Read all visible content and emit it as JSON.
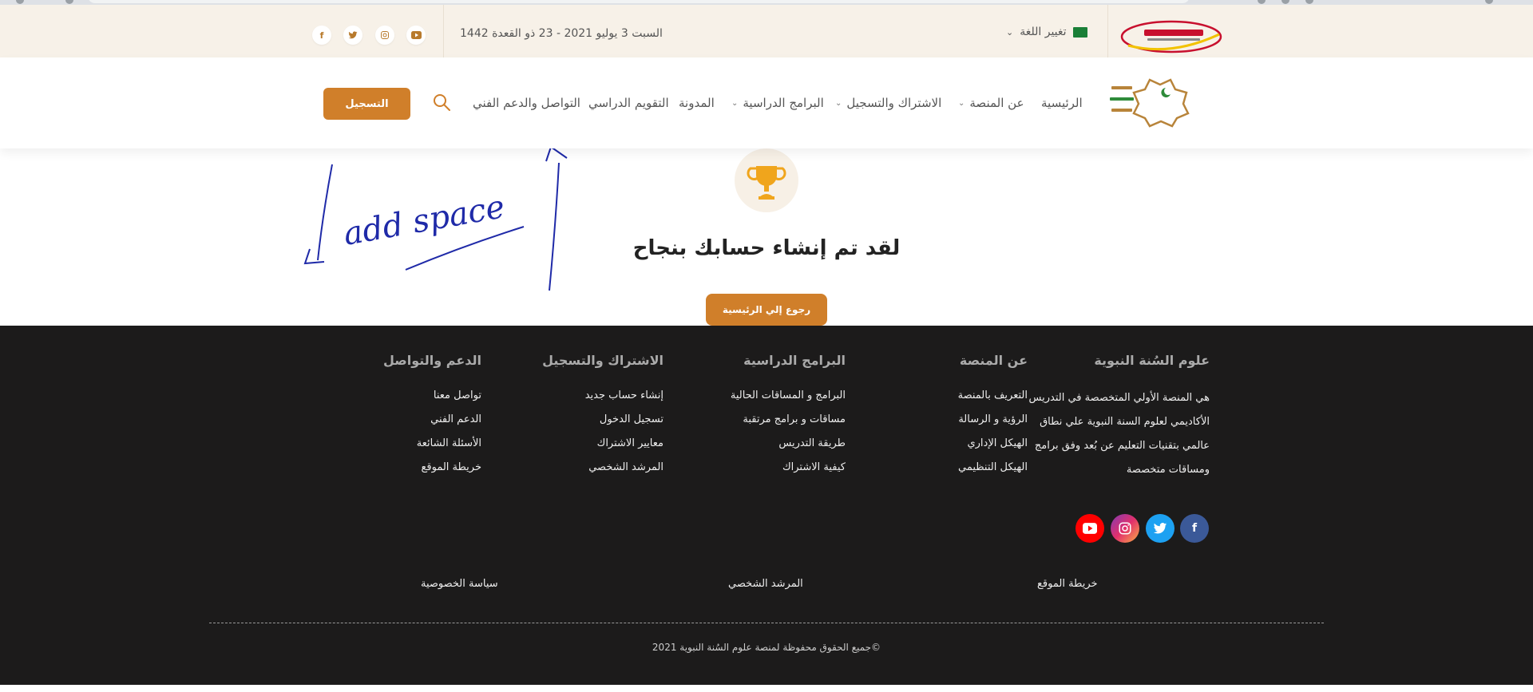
{
  "topbar": {
    "date": "السبت 3 يوليو 2021 - 23 ذو القعدة 1442",
    "language_label": "تغيير اللغة",
    "social": [
      "youtube-icon",
      "instagram-icon",
      "twitter-icon",
      "facebook-icon"
    ]
  },
  "nav": {
    "items": [
      {
        "label": "الرئيسية"
      },
      {
        "label": "عن المنصة"
      },
      {
        "label": "الاشتراك والتسجيل"
      },
      {
        "label": "البرامج الدراسية"
      },
      {
        "label": "المدونة"
      },
      {
        "label": "التقويم الدراسي"
      },
      {
        "label": "التواصل والدعم الفني"
      }
    ],
    "register_label": "التسجيل"
  },
  "main": {
    "success_message": "لقد تم إنشاء حسابك بنجاح",
    "home_button": "رجوع إلي الرئيسية",
    "annotation": "add space"
  },
  "footer": {
    "about": {
      "heading": "علوم السُنة النبوية",
      "text": "هي المنصة الأولي المتخصصة في التدريس الأكاديمي لعلوم السنة النبوية علي نطاق عالمي بتقنيات التعليم عن بُعد وفق برامج ومساقات متخصصة"
    },
    "columns": [
      {
        "heading": "عن المنصة",
        "links": [
          "التعريف بالمنصة",
          "الرؤية و الرسالة",
          "الهيكل الإداري",
          "الهيكل التنظيمي"
        ]
      },
      {
        "heading": "البرامج الدراسية",
        "links": [
          "البرامج و المساقات الحالية",
          "مساقات و برامج مرتقبة",
          "طريقة التدريس",
          "كيفية الاشتراك"
        ]
      },
      {
        "heading": "الاشتراك والتسجيل",
        "links": [
          "إنشاء حساب جديد",
          "تسجيل الدخول",
          "معايير الاشتراك",
          "المرشد الشخصي"
        ]
      },
      {
        "heading": "الدعم والتواصل",
        "links": [
          "تواصل معنا",
          "الدعم الفني",
          "الأسئلة الشائعة",
          "خريطة الموقع"
        ]
      }
    ],
    "bottom_links": [
      "خريطة الموقع",
      "المرشد الشخصي",
      "سياسة الخصوصية"
    ],
    "copyright": "©جميع الحقوق محفوظة لمنصة علوم السُنة النبوية 2021"
  },
  "colors": {
    "accent": "#d07f2a",
    "topbar_bg": "#f7f1e8",
    "footer_bg": "#1c1b1b",
    "facebook": "#3b5998",
    "twitter": "#1da1f2",
    "youtube": "#ff0000"
  }
}
